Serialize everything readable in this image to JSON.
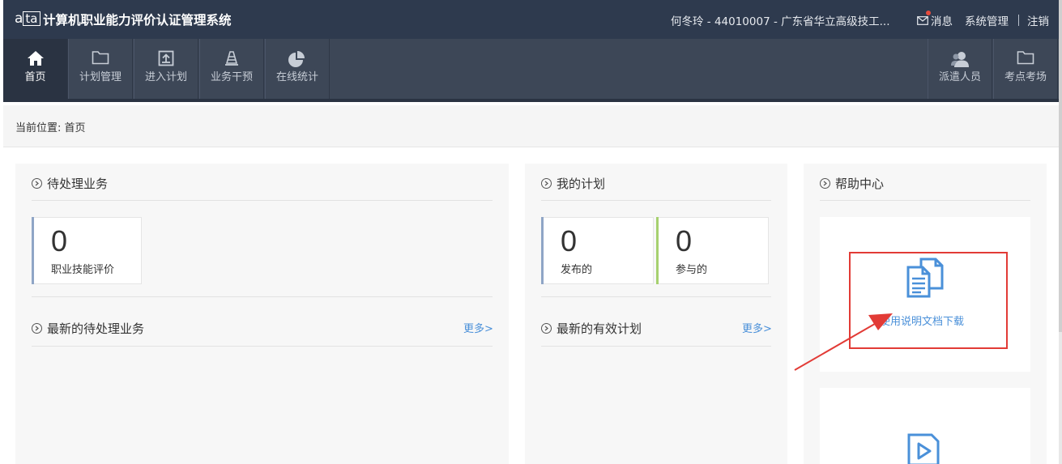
{
  "header": {
    "logo_text": "a",
    "logo_box": "ta",
    "title": "计算机职业能力评价认证管理系统",
    "user": "何冬玲 - 44010007 - 广东省华立高级技工...",
    "messages": "消息",
    "system": "系统管理",
    "logout": "注销"
  },
  "nav": {
    "items": [
      {
        "label": "首页",
        "icon": "home-icon"
      },
      {
        "label": "计划管理",
        "icon": "folder-icon"
      },
      {
        "label": "进入计划",
        "icon": "enter-icon"
      },
      {
        "label": "业务干预",
        "icon": "cone-icon"
      },
      {
        "label": "在线统计",
        "icon": "pie-chart-icon"
      },
      {
        "label": "派遣人员",
        "icon": "users-icon"
      },
      {
        "label": "考点考场",
        "icon": "folder-icon"
      }
    ]
  },
  "breadcrumb": {
    "text": "当前位置: 首页"
  },
  "pending": {
    "title": "待处理业务",
    "card": {
      "value": "0",
      "label": "职业技能评价"
    },
    "latest_title": "最新的待处理业务",
    "more": "更多>"
  },
  "plans": {
    "title": "我的计划",
    "cards": [
      {
        "value": "0",
        "label": "发布的",
        "accent": "#8fa5c6"
      },
      {
        "value": "0",
        "label": "参与的",
        "accent": "#a6d06f"
      }
    ],
    "latest_title": "最新的有效计划",
    "more": "更多>"
  },
  "help": {
    "title": "帮助中心",
    "doc_link": "使用说明文档下载"
  },
  "colors": {
    "header_bg": "#2e3a4e",
    "nav_bg": "#3d4757",
    "link": "#4a90d9",
    "annotation": "#e23b36"
  }
}
